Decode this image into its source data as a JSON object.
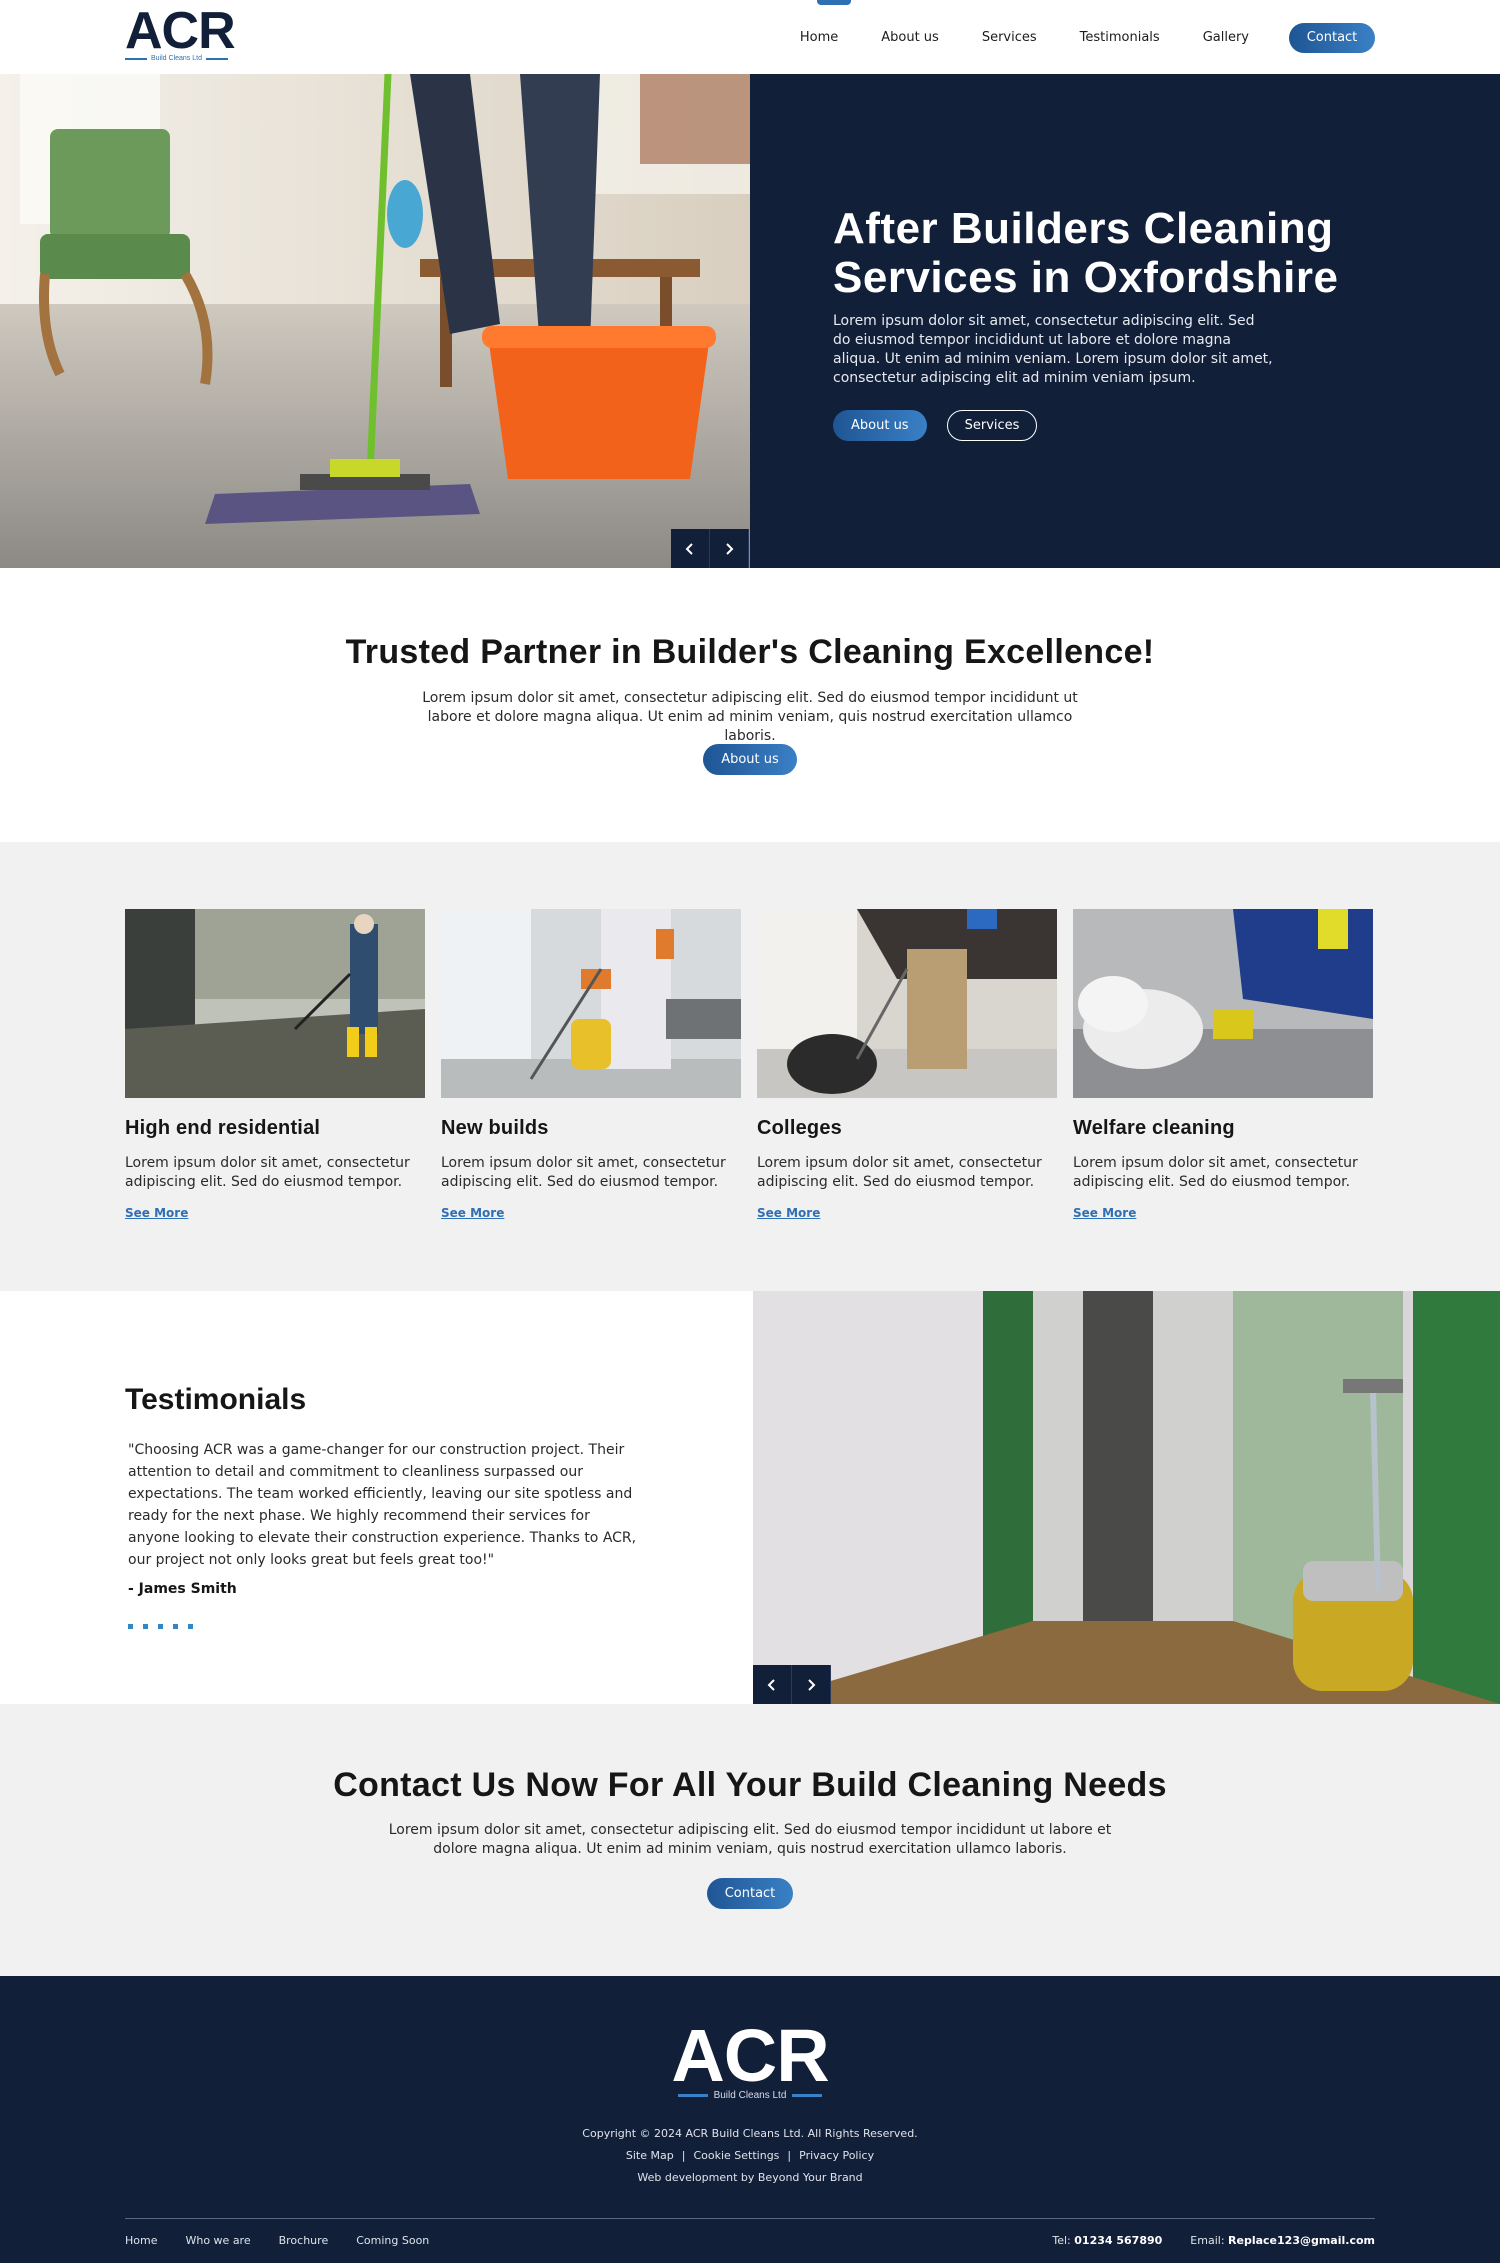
{
  "brand": {
    "logo_text": "ACR",
    "logo_sub": "Build Cleans Ltd",
    "accent_color": "#2f6fb3",
    "navy_color": "#121f39"
  },
  "nav": {
    "items": [
      "Home",
      "About us",
      "Services",
      "Testimonials",
      "Gallery"
    ],
    "contact_label": "Contact"
  },
  "hero": {
    "title": "After Builders Cleaning Services in Oxfordshire",
    "text": "Lorem ipsum dolor sit amet, consectetur adipiscing elit. Sed do eiusmod tempor incididunt ut labore et dolore magna aliqua. Ut enim ad minim veniam. Lorem ipsum dolor sit amet, consectetur adipiscing elit ad minim veniam ipsum.",
    "btn_primary": "About us",
    "btn_secondary": "Services",
    "prev_icon": "chevron-left-icon",
    "next_icon": "chevron-right-icon"
  },
  "trusted": {
    "title": "Trusted Partner in Builder's Cleaning Excellence!",
    "text": "Lorem ipsum dolor sit amet, consectetur adipiscing elit. Sed do eiusmod tempor incididunt ut labore et dolore magna aliqua. Ut enim ad minim veniam, quis nostrud exercitation ullamco laboris.",
    "button": "About us"
  },
  "services": {
    "cards": [
      {
        "title": "High end residential",
        "text": "Lorem ipsum dolor sit amet, consectetur adipiscing elit. Sed do eiusmod tempor.",
        "link": "See More"
      },
      {
        "title": "New builds",
        "text": "Lorem ipsum dolor sit amet, consectetur adipiscing elit. Sed do eiusmod tempor.",
        "link": "See More"
      },
      {
        "title": "Colleges",
        "text": "Lorem ipsum dolor sit amet, consectetur adipiscing elit. Sed do eiusmod tempor.",
        "link": "See More"
      },
      {
        "title": "Welfare cleaning",
        "text": "Lorem ipsum dolor sit amet, consectetur adipiscing elit. Sed do eiusmod tempor.",
        "link": "See More"
      }
    ]
  },
  "testimonials": {
    "title": "Testimonials",
    "quote": "\"Choosing ACR was a game-changer for our construction project. Their attention to detail and commitment to cleanliness surpassed our expectations. The team worked efficiently, leaving our site spotless and ready for the next phase. We highly recommend their services for anyone looking to elevate their construction experience. Thanks to ACR, our project not only looks great but feels great too!\"",
    "author": "-  James Smith"
  },
  "cta": {
    "title": "Contact Us Now For All Your Build Cleaning Needs",
    "text": "Lorem ipsum dolor sit amet, consectetur adipiscing elit. Sed do eiusmod tempor incididunt ut labore et dolore magna aliqua. Ut enim ad minim veniam, quis nostrud exercitation ullamco laboris.",
    "button": "Contact"
  },
  "footer": {
    "copyright": "Copyright © 2024 ACR Build Cleans Ltd. All Rights Reserved.",
    "links": [
      "Site Map",
      "Cookie Settings",
      "Privacy Policy"
    ],
    "dev": "Web development by Beyond Your Brand",
    "bottom_nav": [
      "Home",
      "Who we are",
      "Brochure",
      "Coming Soon"
    ],
    "tel_label": "Tel:",
    "tel": "01234 567890",
    "email_label": "Email:",
    "email": "Replace123@gmail.com"
  }
}
